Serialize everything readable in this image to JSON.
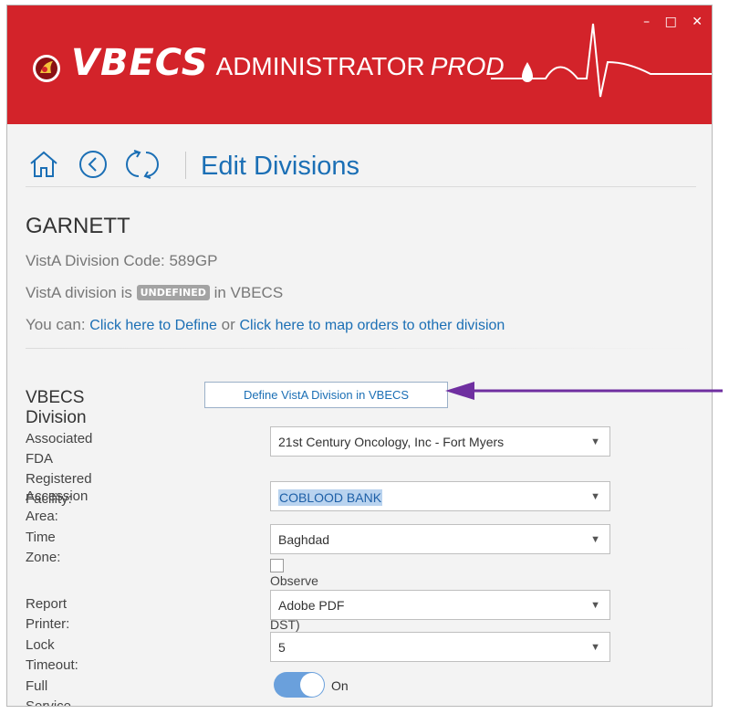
{
  "window": {
    "title_brand": "VBECS",
    "title_app": "ADMINISTRATOR",
    "title_env": "PROD",
    "controls": {
      "minimize": "–",
      "maximize": "□",
      "close": "✕"
    }
  },
  "toolbar": {
    "page_title": "Edit Divisions",
    "icons": [
      "home-icon",
      "back-icon",
      "refresh-icon"
    ]
  },
  "division": {
    "name": "GARNETT",
    "code_line": "VistA Division Code:  589GP",
    "status_prefix": "VistA division is",
    "status_badge": "UNDEFINED",
    "status_suffix": "in VBECS",
    "you_can": "You can:",
    "define_link": "Click here to Define",
    "or_text": "or",
    "map_link": "Click here to map orders to other division"
  },
  "form": {
    "section_label": "VBECS Division",
    "define_button": "Define VistA Division in VBECS",
    "fda_label_line1": "Associated FDA Registered",
    "fda_label_line2": "Facility:",
    "fda_value": "21st Century Oncology, Inc - Fort Myers",
    "accession_label": "Accession Area:",
    "accession_value": "COBLOOD BANK",
    "timezone_label": "Time Zone:",
    "timezone_value": "Baghdad",
    "dst_label": "Observe DST (US Standard DST)",
    "dst_checked": false,
    "printer_label": "Report Printer:",
    "printer_value": "Adobe PDF",
    "lock_label": "Lock Timeout:",
    "lock_value": "5",
    "fullservice_label": "Full Service Division:",
    "fullservice_state": "On",
    "fullservice_on": true
  },
  "colors": {
    "titlebar": "#d3232a",
    "accent_blue": "#1b6fb5",
    "annotation_arrow": "#6f2fa0"
  }
}
